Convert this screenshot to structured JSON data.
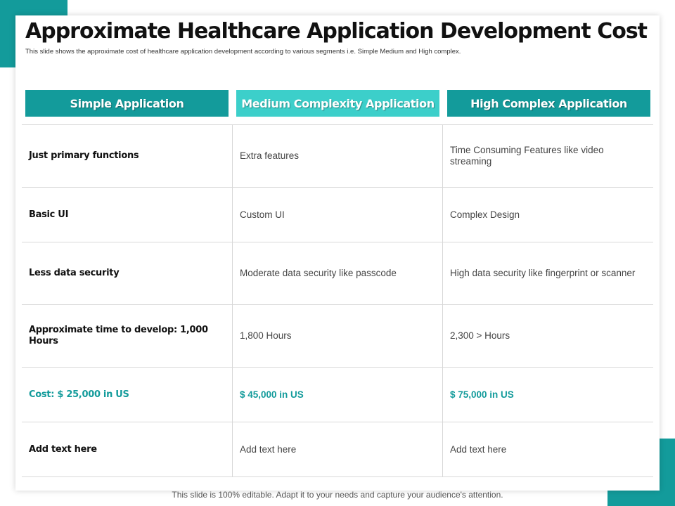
{
  "title": "Approximate Healthcare Application Development Cost",
  "subtitle": "This slide shows the approximate cost of healthcare application development according to various segments i.e. Simple Medium and High complex.",
  "columns": [
    "Simple Application",
    "Medium Complexity Application",
    "High Complex Application"
  ],
  "rows": [
    [
      "Just primary functions",
      "Extra features",
      "Time Consuming Features like video streaming"
    ],
    [
      "Basic UI",
      "Custom UI",
      "Complex Design"
    ],
    [
      "Less data security",
      "Moderate data security like passcode",
      "High data security like fingerprint or scanner"
    ],
    [
      "Approximate time to develop: 1,000 Hours",
      "1,800 Hours",
      "2,300 > Hours"
    ],
    [
      "Cost: $ 25,000 in US",
      "$ 45,000 in US",
      "$ 75,000 in US"
    ],
    [
      "Add text here",
      "Add text here",
      "Add text here"
    ]
  ],
  "footer": "This slide is 100% editable. Adapt it to your needs and capture your audience's attention.",
  "colors": {
    "accent": "#139b9b",
    "accent_light": "#3ccfca"
  }
}
